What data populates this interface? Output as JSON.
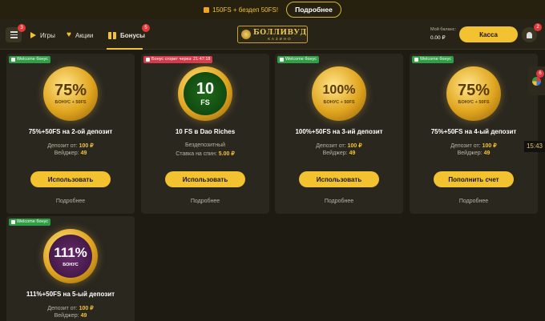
{
  "promo": {
    "text": "150FS + бездеп 50FS!",
    "button": "Подробнее"
  },
  "header": {
    "menu_badge": "3",
    "nav": [
      {
        "label": "Игры"
      },
      {
        "label": "Акции"
      },
      {
        "label": "Бонусы",
        "badge": "5"
      }
    ],
    "logo_title": "БОЛЛИВУД",
    "logo_sub": "КАЗИНО",
    "balance_label": "Мой баланс:",
    "balance_value": "0.00 ₽",
    "cashier": "Касса",
    "bell_badge": "2"
  },
  "cards": [
    {
      "tag": "Welcome бонус",
      "tag_color": "#2f9e44",
      "med_big": "75%",
      "med_sub": "БОНУС + 50FS",
      "title": "75%+50FS на 2-ой депозит",
      "line1_label": "Депозит от:",
      "line1_value": "100 ₽",
      "line2_label": "Вейджер:",
      "line2_value": "49",
      "button": "Использовать",
      "more": "Подробнее"
    },
    {
      "tag": "Бонус сгорит через: 21:47:18",
      "tag_color": "#d63a4a",
      "med_big": "10",
      "med_sub": "FS",
      "title": "10 FS в Dao Riches",
      "line1_label": "Бездепозитный",
      "line1_value": "",
      "line2_label": "Ставка на спин:",
      "line2_value": "5.00 ₽",
      "button": "Использовать",
      "more": "Подробнее"
    },
    {
      "tag": "Welcome бонус",
      "tag_color": "#2f9e44",
      "med_big": "100%",
      "med_sub": "БОНУС + 50FS",
      "title": "100%+50FS на 3-ий депозит",
      "line1_label": "Депозит от:",
      "line1_value": "100 ₽",
      "line2_label": "Вейджер:",
      "line2_value": "49",
      "button": "Использовать",
      "more": "Подробнее"
    },
    {
      "tag": "Welcome бонус",
      "tag_color": "#2f9e44",
      "med_big": "75%",
      "med_sub": "БОНУС + 50FS",
      "title": "75%+50FS на 4-ый депозит",
      "line1_label": "Депозит от:",
      "line1_value": "100 ₽",
      "line2_label": "Вейджер:",
      "line2_value": "49",
      "button": "Пополнить счет",
      "more": "Подробнее"
    },
    {
      "tag": "Welcome бонус",
      "tag_color": "#2f9e44",
      "med_big": "111%",
      "med_sub": "БОНУС",
      "title": "111%+50FS на 5-ый депозит",
      "line1_label": "Депозит от:",
      "line1_value": "100 ₽",
      "line2_label": "Вейджер:",
      "line2_value": "49",
      "button": "",
      "more": ""
    }
  ],
  "side": {
    "widget_badge": "6",
    "time": "15:43"
  }
}
